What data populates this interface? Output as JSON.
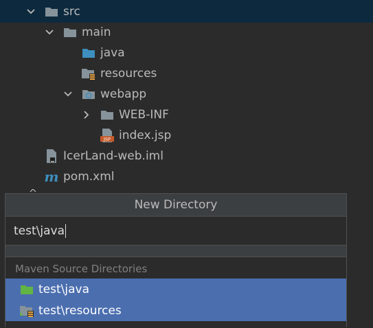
{
  "project_tree": {
    "nodes": [
      {
        "label": "src",
        "icon": "folder-icon",
        "expanded": true
      },
      {
        "label": "main",
        "icon": "folder-icon",
        "expanded": true
      },
      {
        "label": "java",
        "icon": "source-folder-icon"
      },
      {
        "label": "resources",
        "icon": "resources-folder-icon"
      },
      {
        "label": "webapp",
        "icon": "web-folder-icon",
        "expanded": true
      },
      {
        "label": "WEB-INF",
        "icon": "folder-icon",
        "expanded": false
      },
      {
        "label": "index.jsp",
        "icon": "jsp-file-icon"
      },
      {
        "label": "IcerLand-web.iml",
        "icon": "iml-file-icon"
      },
      {
        "label": "pom.xml",
        "icon": "maven-icon"
      }
    ]
  },
  "dialog": {
    "title": "New Directory",
    "input_value": "test\\java",
    "section_label": "Maven Source Directories",
    "suggestions": [
      {
        "label": "test\\java",
        "icon": "test-source-folder-icon"
      },
      {
        "label": "test\\resources",
        "icon": "test-resources-folder-icon"
      }
    ]
  },
  "colors": {
    "background": "#2b2b2b",
    "selection": "#4b6eaf",
    "folder": "#87939a",
    "source_folder": "#3d8fbf",
    "test_folder": "#62b543"
  }
}
